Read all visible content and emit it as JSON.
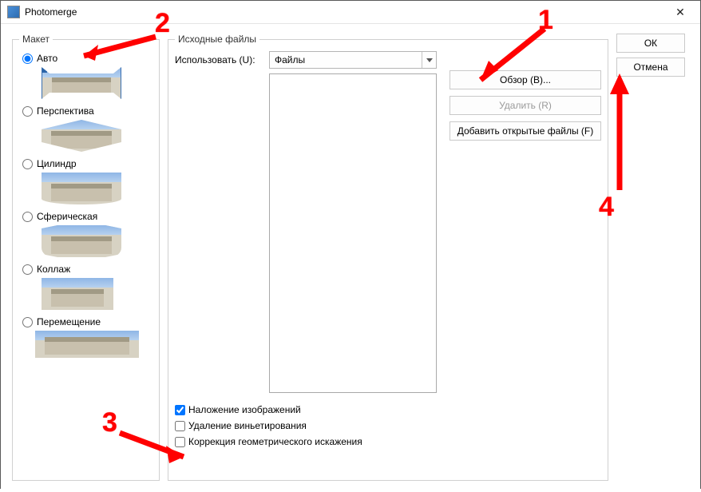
{
  "window": {
    "title": "Photomerge",
    "close_glyph": "✕"
  },
  "layout": {
    "group_label": "Макет",
    "options": {
      "auto": "Авто",
      "perspective": "Перспектива",
      "cylinder": "Цилиндр",
      "spherical": "Сферическая",
      "collage": "Коллаж",
      "reposition": "Перемещение"
    },
    "selected": "auto"
  },
  "source": {
    "group_label": "Исходные файлы",
    "use_label": "Использовать (U):",
    "use_value": "Файлы",
    "buttons": {
      "browse": "Обзор (B)...",
      "remove": "Удалить (R)",
      "add_open": "Добавить открытые файлы (F)"
    },
    "checks": {
      "blend": "Наложение изображений",
      "vignette": "Удаление виньетирования",
      "geom": "Коррекция геометрического искажения"
    },
    "checks_state": {
      "blend": true,
      "vignette": false,
      "geom": false
    }
  },
  "actions": {
    "ok": "ОК",
    "cancel": "Отмена"
  },
  "annotations": {
    "n1": "1",
    "n2": "2",
    "n3": "3",
    "n4": "4"
  }
}
